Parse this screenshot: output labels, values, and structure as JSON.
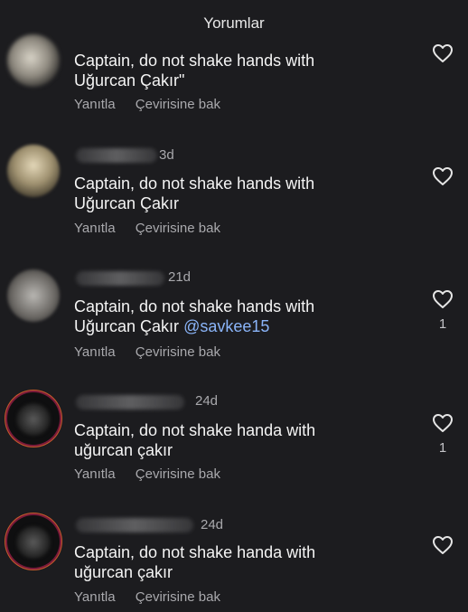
{
  "header": {
    "title": "Yorumlar"
  },
  "comments": [
    {
      "time": "",
      "text": "Captain, do not shake hands with",
      "text2": "Uğurcan Çakır\"",
      "reply": "Yanıtla",
      "translate": "Çevirisine bak",
      "likes": ""
    },
    {
      "time": "3d",
      "text": "Captain, do not shake hands with",
      "text2": "Uğurcan Çakır",
      "reply": "Yanıtla",
      "translate": "Çevirisine bak",
      "likes": ""
    },
    {
      "time": "21d",
      "text": "Captain, do not shake hands with",
      "text2": "Uğurcan Çakır",
      "mention": "@savkee15",
      "reply": "Yanıtla",
      "translate": "Çevirisine bak",
      "likes": "1"
    },
    {
      "time": "24d",
      "text": "Captain, do not shake handa with",
      "text2": "uğurcan çakır",
      "reply": "Yanıtla",
      "translate": "Çevirisine bak",
      "likes": "1"
    },
    {
      "time": "24d",
      "text": "Captain, do not shake handa with",
      "text2": "uğurcan çakır",
      "reply": "Yanıtla",
      "translate": "Çevirisine bak",
      "likes": ""
    }
  ],
  "icons": {
    "like": "heart-icon",
    "avatar": "avatar"
  }
}
